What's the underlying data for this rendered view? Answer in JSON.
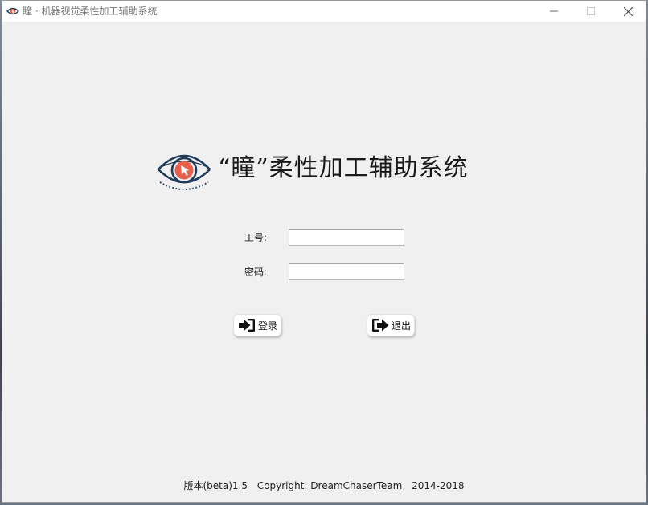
{
  "window": {
    "title": "瞳 · 机器视觉柔性加工辅助系统",
    "controls": {
      "minimize": "minimize",
      "maximize": "maximize",
      "close": "close"
    }
  },
  "header": {
    "app_name": "“瞳”柔性加工辅助系统",
    "logo": "eye-cursor-icon"
  },
  "form": {
    "employee_id_label": "工号:",
    "employee_id_value": "",
    "password_label": "密码:",
    "password_value": ""
  },
  "buttons": {
    "login_label": "登录",
    "login_icon": "login-arrow-icon",
    "exit_label": "退出",
    "exit_icon": "exit-arrow-icon"
  },
  "footer": {
    "version": "版本(beta)1.5",
    "copyright": "Copyright: DreamChaserTeam",
    "years": "2014-2018"
  },
  "colors": {
    "logo_navy": "#1f3a5a",
    "logo_accent": "#e8604c",
    "window_bg": "#f0f0f0"
  }
}
